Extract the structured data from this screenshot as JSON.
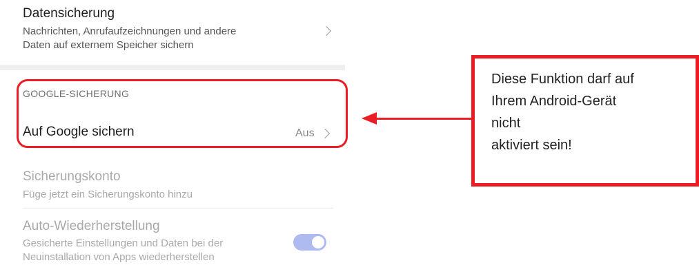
{
  "settings": {
    "backup": {
      "title": "Datensicherung",
      "subtitle_line1": "Nachrichten, Anrufaufzeichnungen und andere",
      "subtitle_line2": "Daten auf externem Speicher sichern"
    },
    "google_section": {
      "header": "GOOGLE-SICHERUNG",
      "backup_to_google": {
        "title": "Auf Google sichern",
        "value": "Aus"
      }
    },
    "backup_account": {
      "title": "Sicherungskonto",
      "subtitle": "Füge jetzt ein Sicherungskonto hinzu"
    },
    "auto_restore": {
      "title": "Auto-Wiederherstellung",
      "subtitle_line1": "Gesicherte Einstellungen und Daten bei der",
      "subtitle_line2": "Neuinstallation von Apps wiederherstellen",
      "toggle_state": "on"
    }
  },
  "annotation": {
    "color": "#ec1c24",
    "lines": [
      "Diese Funktion darf auf",
      "Ihrem Android-Gerät",
      "nicht",
      "aktiviert sein!"
    ]
  }
}
